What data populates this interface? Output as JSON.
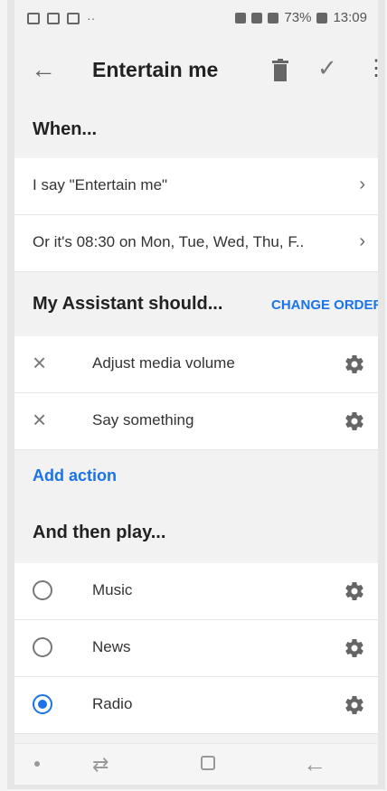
{
  "status_bar": {
    "left_icons": [
      "gallery-icon",
      "sim-icon",
      "photo-icon",
      "more-dots-icon"
    ],
    "more": "··",
    "battery": "73%",
    "time": "13:09"
  },
  "app_bar": {
    "back_icon": "arrow-left-icon",
    "title": "Entertain me",
    "trash_icon": "trash-icon",
    "check_icon": "check-icon",
    "more_icon": "more-vert-icon"
  },
  "when": {
    "header": "When...",
    "rows": [
      {
        "label": "I say \"Entertain me\"",
        "chev": "›"
      },
      {
        "label": "Or it's 08:30 on Mon, Tue, Wed, Thu, F..",
        "chev": "›"
      }
    ]
  },
  "assistant": {
    "header": "My Assistant should...",
    "change_order": "CHANGE ORDER",
    "actions": [
      {
        "label": "Adjust media volume",
        "x": "×"
      },
      {
        "label": "Say something",
        "x": "×"
      }
    ],
    "add_action": "Add action"
  },
  "play": {
    "header": "And then play...",
    "options": [
      {
        "label": "Music",
        "selected": false
      },
      {
        "label": "News",
        "selected": false
      },
      {
        "label": "Radio",
        "selected": true
      }
    ]
  },
  "nav_bar": {
    "dot_icon": "dot-icon",
    "recents_icon": "recents-icon",
    "home_icon": "home-icon",
    "back_icon": "back-nav-icon"
  },
  "colors": {
    "accent": "#1a73e8"
  }
}
